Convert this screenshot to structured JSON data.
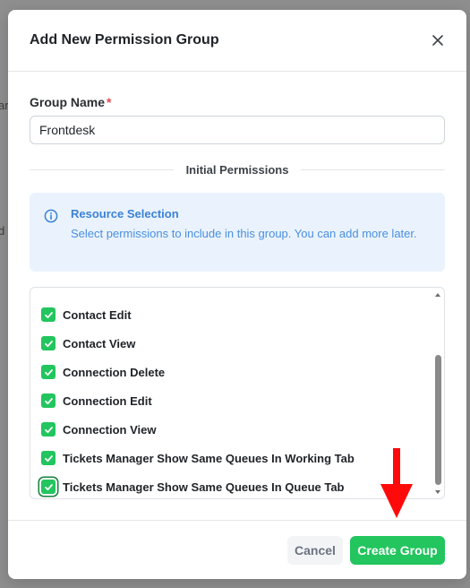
{
  "modal": {
    "title": "Add New Permission Group"
  },
  "form": {
    "group_name_label": "Group Name",
    "required_mark": "*",
    "group_name_value": "Frontdesk"
  },
  "section": {
    "initial_permissions_label": "Initial Permissions"
  },
  "info": {
    "title": "Resource Selection",
    "description": "Select permissions to include in this group. You can add more later."
  },
  "permissions": [
    {
      "label": "Contact Edit",
      "checked": true
    },
    {
      "label": "Contact View",
      "checked": true
    },
    {
      "label": "Connection Delete",
      "checked": true
    },
    {
      "label": "Connection Edit",
      "checked": true
    },
    {
      "label": "Connection View",
      "checked": true
    },
    {
      "label": "Tickets Manager Show Same Queues In Working Tab",
      "checked": true
    },
    {
      "label": "Tickets Manager Show Same Queues In Queue Tab",
      "checked": true
    }
  ],
  "footer": {
    "cancel_label": "Cancel",
    "create_label": "Create Group"
  },
  "colors": {
    "accent": "#22c55e",
    "info_bg": "#eaf3fd",
    "info_text": "#3b82d6",
    "annotation": "#ff0000"
  }
}
